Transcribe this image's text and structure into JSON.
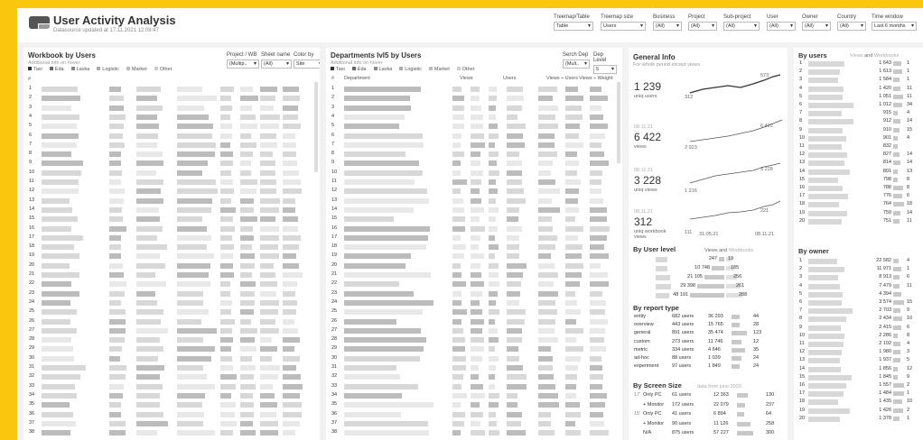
{
  "header": {
    "title": "User Activity Analysis",
    "subtitle": "Datasource updated at 17.11.2021 12:08:47"
  },
  "filters": [
    {
      "label": "Treemap/Table",
      "value": "Table"
    },
    {
      "label": "Treemap size",
      "value": "Users"
    },
    {
      "label": "Business",
      "value": "(All)"
    },
    {
      "label": "Project",
      "value": "(All)"
    },
    {
      "label": "Sub-project",
      "value": "(All)"
    },
    {
      "label": "User",
      "value": "(All)"
    },
    {
      "label": "Owner",
      "value": "(All)"
    },
    {
      "label": "Country",
      "value": "(All)"
    },
    {
      "label": "Time window",
      "value": "Last 6 months"
    }
  ],
  "workbook": {
    "title": "Workbook by Users",
    "subtitle": "Additional info on hover",
    "filters": [
      {
        "label": "Project / WB",
        "value": "(Multip.."
      },
      {
        "label": "Sheet name",
        "value": "(All)"
      },
      {
        "label": "Color by",
        "value": "Site"
      }
    ],
    "legend": [
      "Taxi",
      "Eda",
      "Lavka",
      "Logistic",
      "Market",
      "Other"
    ],
    "hash": "#"
  },
  "departments": {
    "title": "Departments lvl5 by Users",
    "subtitle": "Additional info on hover",
    "filters": [
      {
        "label": "Serch Dep",
        "value": "(Mult.."
      },
      {
        "label": "Dep Level",
        "value": "5"
      }
    ],
    "legend": [
      "Taxi",
      "Eda",
      "Lavka",
      "Logistic",
      "Market",
      "Other"
    ],
    "columns": [
      "#",
      "Department",
      "Views",
      "Users",
      "Views ÷ Users",
      "Views ÷ Weight"
    ]
  },
  "general": {
    "title": "General Info",
    "subtitle": "For whole period except views",
    "metrics": [
      {
        "value": "1 239",
        "label": "uniq users",
        "date": "",
        "start": "312",
        "end": "573"
      },
      {
        "value": "6 422",
        "label": "views",
        "date": "08.11.21",
        "start": "2 923",
        "end": "6 422"
      },
      {
        "value": "3 228",
        "label": "uniq views",
        "date": "08.11.21",
        "start": "1 216",
        "end": "3 228"
      },
      {
        "value": "312",
        "label": "uniq workbook views",
        "date": "08.11.21",
        "start": "111",
        "end": "221"
      }
    ],
    "axis_start": "31.05.21",
    "axis_end": "08.11.21"
  },
  "user_level": {
    "title": "By User level",
    "legend_a": "Views",
    "legend_and": "and",
    "legend_b": "Workbooks",
    "rows": [
      {
        "views": "247",
        "wb": "19"
      },
      {
        "views": "10 748",
        "wb": "185"
      },
      {
        "views": "21 105",
        "wb": "256"
      },
      {
        "views": "29 398",
        "wb": "261"
      },
      {
        "views": "48 191",
        "wb": "288"
      }
    ]
  },
  "report_type": {
    "title": "By report type",
    "rows": [
      {
        "name": "entity",
        "users": "682 users",
        "views": "36 293",
        "wb": "44"
      },
      {
        "name": "overview",
        "users": "443 users",
        "views": "15 765",
        "wb": "28"
      },
      {
        "name": "general",
        "users": "891 users",
        "views": "35 474",
        "wb": "123"
      },
      {
        "name": "custom",
        "users": "273 users",
        "views": "11 746",
        "wb": "12"
      },
      {
        "name": "metric",
        "users": "334 users",
        "views": "4 646",
        "wb": "35"
      },
      {
        "name": "ad-hoc",
        "users": "88 users",
        "views": "1 039",
        "wb": "24"
      },
      {
        "name": "experiment",
        "users": "97 users",
        "views": "1 849",
        "wb": "24"
      }
    ]
  },
  "screen": {
    "title": "By Screen Size",
    "note": "data from june 2020",
    "rows": [
      {
        "g": "17'",
        "name": "Only PC",
        "users": "61 users",
        "views": "12 363",
        "wb": "130"
      },
      {
        "g": "",
        "name": "+ Monitor",
        "users": "172 users",
        "views": "22 079",
        "wb": "237"
      },
      {
        "g": "15'",
        "name": "Only PC",
        "users": "41 users",
        "views": "6 894",
        "wb": "64"
      },
      {
        "g": "",
        "name": "+ Monitor",
        "users": "90 users",
        "views": "11 126",
        "wb": "258"
      },
      {
        "g": "",
        "name": "N/A",
        "users": "875 users",
        "views": "57 227",
        "wb": "300"
      }
    ]
  },
  "by_users": {
    "title": "By users",
    "legend_a": "Views",
    "legend_and": "and",
    "legend_b": "Workbooks",
    "rows": [
      {
        "v": "1 643",
        "w": "1"
      },
      {
        "v": "1 613",
        "w": "1"
      },
      {
        "v": "1 584",
        "w": "1"
      },
      {
        "v": "1 420",
        "w": "11"
      },
      {
        "v": "1 051",
        "w": "11"
      },
      {
        "v": "1 012",
        "w": "34"
      },
      {
        "v": "915",
        "w": "4"
      },
      {
        "v": "912",
        "w": "14"
      },
      {
        "v": "910",
        "w": "15"
      },
      {
        "v": "901",
        "w": "4"
      },
      {
        "v": "832",
        "w": ""
      },
      {
        "v": "827",
        "w": "14"
      },
      {
        "v": "814",
        "w": "14"
      },
      {
        "v": "801",
        "w": "13"
      },
      {
        "v": "798",
        "w": "8"
      },
      {
        "v": "788",
        "w": "8"
      },
      {
        "v": "776",
        "w": "6"
      },
      {
        "v": "764",
        "w": "18"
      },
      {
        "v": "759",
        "w": "14"
      },
      {
        "v": "751",
        "w": "11"
      }
    ]
  },
  "by_owner": {
    "title": "By owner",
    "rows": [
      {
        "v": "22 582",
        "w": "4"
      },
      {
        "v": "11 971",
        "w": "1"
      },
      {
        "v": "8 913",
        "w": "6"
      },
      {
        "v": "7 479",
        "w": "11"
      },
      {
        "v": "4 394",
        "w": ""
      },
      {
        "v": "3 574",
        "w": "15"
      },
      {
        "v": "2 703",
        "w": "9"
      },
      {
        "v": "2 434",
        "w": "10"
      },
      {
        "v": "2 415",
        "w": "6"
      },
      {
        "v": "2 286",
        "w": "8"
      },
      {
        "v": "2 102",
        "w": "4"
      },
      {
        "v": "1 980",
        "w": "3"
      },
      {
        "v": "1 937",
        "w": "5"
      },
      {
        "v": "1 856",
        "w": "12"
      },
      {
        "v": "1 845",
        "w": "9"
      },
      {
        "v": "1 557",
        "w": "2"
      },
      {
        "v": "1 484",
        "w": "1"
      },
      {
        "v": "1 435",
        "w": "10"
      },
      {
        "v": "1 426",
        "w": "2"
      },
      {
        "v": "1 378",
        "w": "1"
      }
    ]
  }
}
